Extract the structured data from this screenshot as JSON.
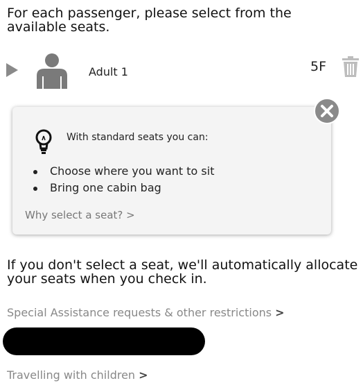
{
  "intro_text": "For each passenger, please select from the available seats.",
  "passenger": {
    "label": "Adult 1",
    "seat": "5F",
    "icons": {
      "expand": "play-icon",
      "person": "person-icon",
      "remove": "trash-icon"
    }
  },
  "tip": {
    "title": "With standard seats you can:",
    "benefits": [
      "Choose where you want to sit",
      "Bring one cabin bag"
    ],
    "why_link": "Why select a seat? >",
    "icons": {
      "bulb": "lightbulb-icon",
      "close": "close-icon"
    }
  },
  "auto_allocate_text": "If you don't select a seat, we'll automatically allocate your seats when you check in.",
  "links": {
    "special_assistance": "Special Assistance requests & other restrictions",
    "travelling_children": "Travelling with children",
    "chevron": ">"
  },
  "colors": {
    "muted_text": "#888888",
    "icon_grey": "#8a8a8a",
    "tip_background": "#f4f4f4",
    "redaction": "#000000"
  }
}
